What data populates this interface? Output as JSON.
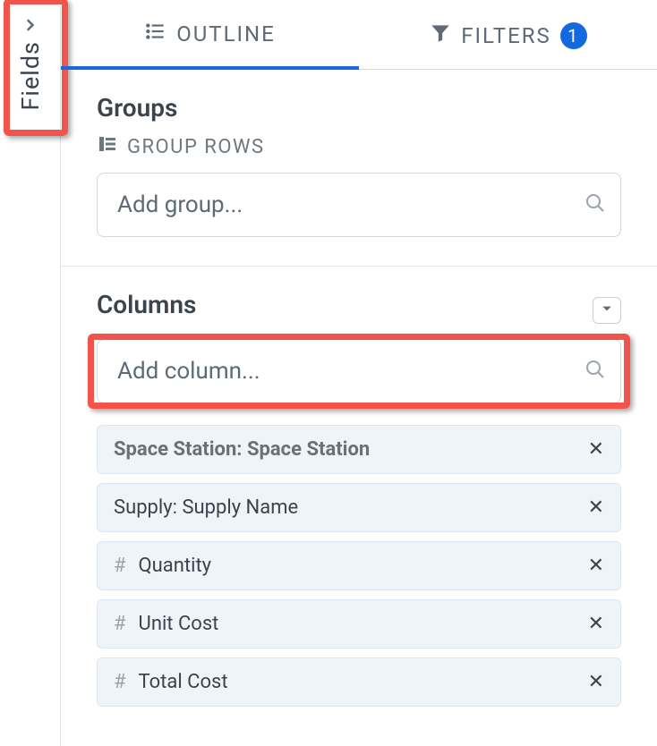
{
  "sidebar": {
    "fields_label": "Fields"
  },
  "tabs": {
    "outline_label": "OUTLINE",
    "filters_label": "FILTERS",
    "filters_count": "1"
  },
  "groups": {
    "title": "Groups",
    "subhead": "GROUP ROWS",
    "placeholder": "Add group..."
  },
  "columns": {
    "title": "Columns",
    "placeholder": "Add column...",
    "items": [
      {
        "label": "Space Station: Space Station",
        "numeric": false,
        "bold": true
      },
      {
        "label": "Supply: Supply Name",
        "numeric": false,
        "bold": false
      },
      {
        "label": "Quantity",
        "numeric": true,
        "bold": false
      },
      {
        "label": "Unit Cost",
        "numeric": true,
        "bold": false
      },
      {
        "label": "Total Cost",
        "numeric": true,
        "bold": false
      }
    ]
  }
}
